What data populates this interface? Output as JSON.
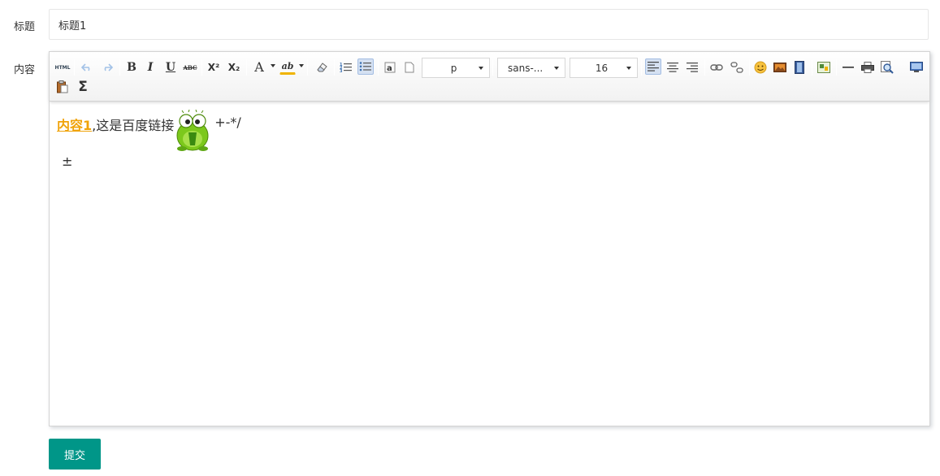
{
  "form": {
    "title_label": "标题",
    "title_value": "标题1",
    "content_label": "内容",
    "submit_label": "提交"
  },
  "toolbar": {
    "source_label": "HTML",
    "bold_label": "B",
    "italic_label": "I",
    "underline_label": "U",
    "strike_label": "ABC",
    "superscript_label": "X²",
    "subscript_label": "X₂",
    "forecolor_label": "A",
    "backcolor_label": "ab",
    "formula_label": "Σ",
    "paragraph_value": "p",
    "fontfamily_value": "sans-...",
    "fontsize_value": "16",
    "active_buttons": [
      "unordered-list",
      "align-left"
    ],
    "disabled_buttons": [
      "undo",
      "redo"
    ]
  },
  "editor": {
    "link_text": "内容1",
    "text_after_link": ",这是百度链接",
    "emoticon": "frog-emoticon",
    "text_after_emoticon": "+-*/",
    "line2_text": "±",
    "link_color": "#f0a30a"
  },
  "colors": {
    "accent": "#009688",
    "active_button_bg": "#d5e1f2"
  }
}
